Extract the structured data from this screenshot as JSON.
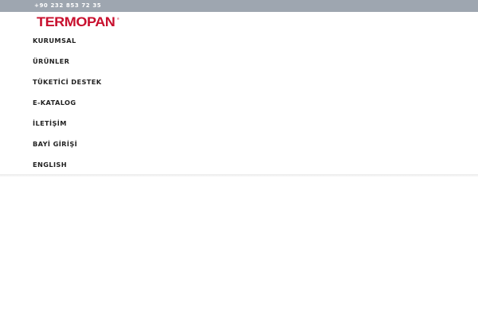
{
  "topbar": {
    "phone": "+90 232 853 72 35"
  },
  "brand": {
    "logo_text": "TERMOPAN",
    "registered_mark": "®",
    "color": "#c8102e"
  },
  "nav": {
    "items": [
      {
        "label": "KURUMSAL"
      },
      {
        "label": "ÜRÜNLER"
      },
      {
        "label": "TÜKETİCİ DESTEK"
      },
      {
        "label": "E-KATALOG"
      },
      {
        "label": "İLETİŞİM"
      },
      {
        "label": "BAYİ GİRİŞİ"
      },
      {
        "label": "ENGLISH"
      }
    ]
  },
  "colors": {
    "topbar_bg": "#9ea6b0",
    "nav_text": "#222222"
  }
}
